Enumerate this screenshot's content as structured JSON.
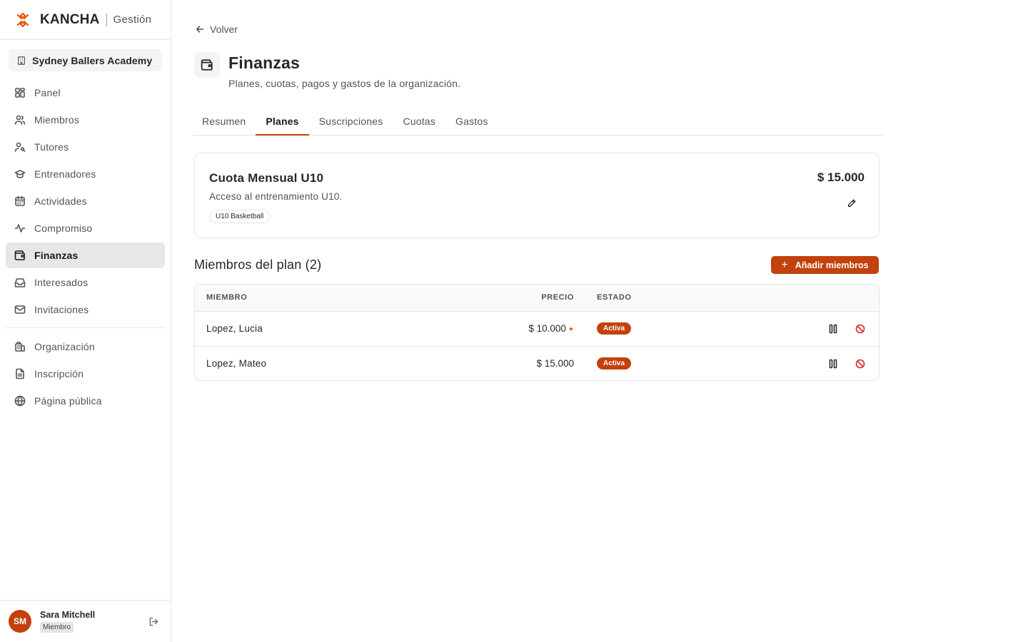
{
  "brand": {
    "name": "KANCHA",
    "sub": "Gestión"
  },
  "org": {
    "name": "Sydney Ballers Academy"
  },
  "sidebar": {
    "items": [
      {
        "label": "Panel",
        "icon": "grid-icon"
      },
      {
        "label": "Miembros",
        "icon": "users-icon"
      },
      {
        "label": "Tutores",
        "icon": "user-key-icon"
      },
      {
        "label": "Entrenadores",
        "icon": "graduation-cap-icon"
      },
      {
        "label": "Actividades",
        "icon": "calendar-icon"
      },
      {
        "label": "Compromiso",
        "icon": "activity-icon"
      },
      {
        "label": "Finanzas",
        "icon": "wallet-icon",
        "active": true
      },
      {
        "label": "Interesados",
        "icon": "inbox-icon"
      },
      {
        "label": "Invitaciones",
        "icon": "mail-icon"
      }
    ],
    "secondary": [
      {
        "label": "Organización",
        "icon": "building-icon"
      },
      {
        "label": "Inscripción",
        "icon": "file-text-icon"
      },
      {
        "label": "Página pública",
        "icon": "globe-icon"
      }
    ]
  },
  "user": {
    "initials": "SM",
    "name": "Sara Mitchell",
    "role": "Miembro"
  },
  "main": {
    "back_label": "Volver",
    "title": "Finanzas",
    "subtitle": "Planes, cuotas, pagos y gastos de la organización.",
    "tabs": [
      {
        "label": "Resumen"
      },
      {
        "label": "Planes",
        "active": true
      },
      {
        "label": "Suscripciones"
      },
      {
        "label": "Cuotas"
      },
      {
        "label": "Gastos"
      }
    ]
  },
  "plan": {
    "name": "Cuota Mensual U10",
    "description": "Acceso al entrenamiento U10.",
    "tag": "U10 Basketball",
    "price": "$ 15.000"
  },
  "members": {
    "title": "Miembros del plan (2)",
    "add_label": "Añadir miembros",
    "columns": {
      "member": "MIEMBRO",
      "price": "PRECIO",
      "status": "ESTADO"
    },
    "rows": [
      {
        "name": "Lopez, Lucia",
        "price": "$ 10.000",
        "custom_price_marker": "★",
        "status": "Activa"
      },
      {
        "name": "Lopez, Mateo",
        "price": "$ 15.000",
        "custom_price_marker": "",
        "status": "Activa"
      }
    ]
  },
  "colors": {
    "accent": "#c2410c",
    "danger": "#dc2626",
    "active_nav_bg": "#e7e7e7"
  }
}
